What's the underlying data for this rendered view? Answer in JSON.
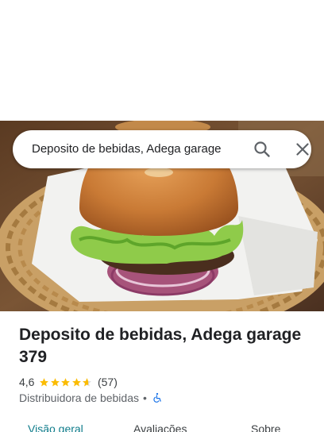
{
  "search": {
    "query": "Deposito de bebidas, Adega garage"
  },
  "place": {
    "name": "Deposito de bebidas, Adega garage 379",
    "rating": "4,6",
    "stars": 4.6,
    "review_count": "(57)",
    "category": "Distribuidora de bebidas",
    "separator": "•"
  },
  "tabs": [
    {
      "label": "Visão geral"
    },
    {
      "label": "Avaliações"
    },
    {
      "label": "Sobre"
    }
  ],
  "colors": {
    "accent": "#0f7c8b",
    "star": "#fbbc04",
    "accessibility": "#1a73e8"
  }
}
